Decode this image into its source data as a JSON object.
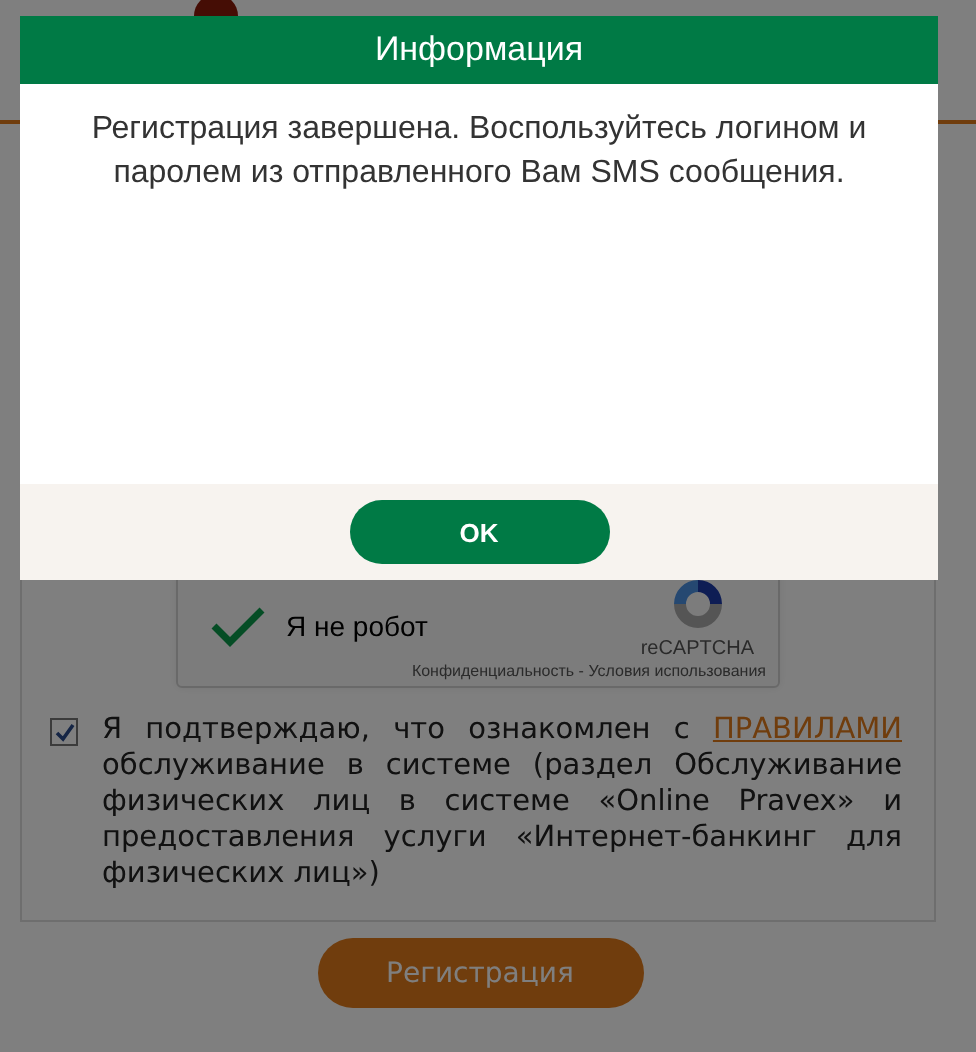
{
  "dialog": {
    "title": "Информация",
    "message": "Регистрация завершена. Воспользуйтесь логином и паролем из отправленного Вам SMS сообщения.",
    "buttons": [
      "OK"
    ]
  },
  "captcha": {
    "label": "Я не робот",
    "checked": true,
    "brand": "reCAPTCHA",
    "links": "Конфиденциальность - Условия использования"
  },
  "agreement": {
    "checked": true,
    "text_before": "Я подтверждаю, что ознакомлен с",
    "link": "ПРАВИЛАМИ",
    "text_after": "обслуживание в системе (раздел Обслуживание физических лиц в системе «Online Pravex» и предоставления услуги «Интернет-банкинг для физических лиц»)"
  },
  "register_button": "Регистрация"
}
